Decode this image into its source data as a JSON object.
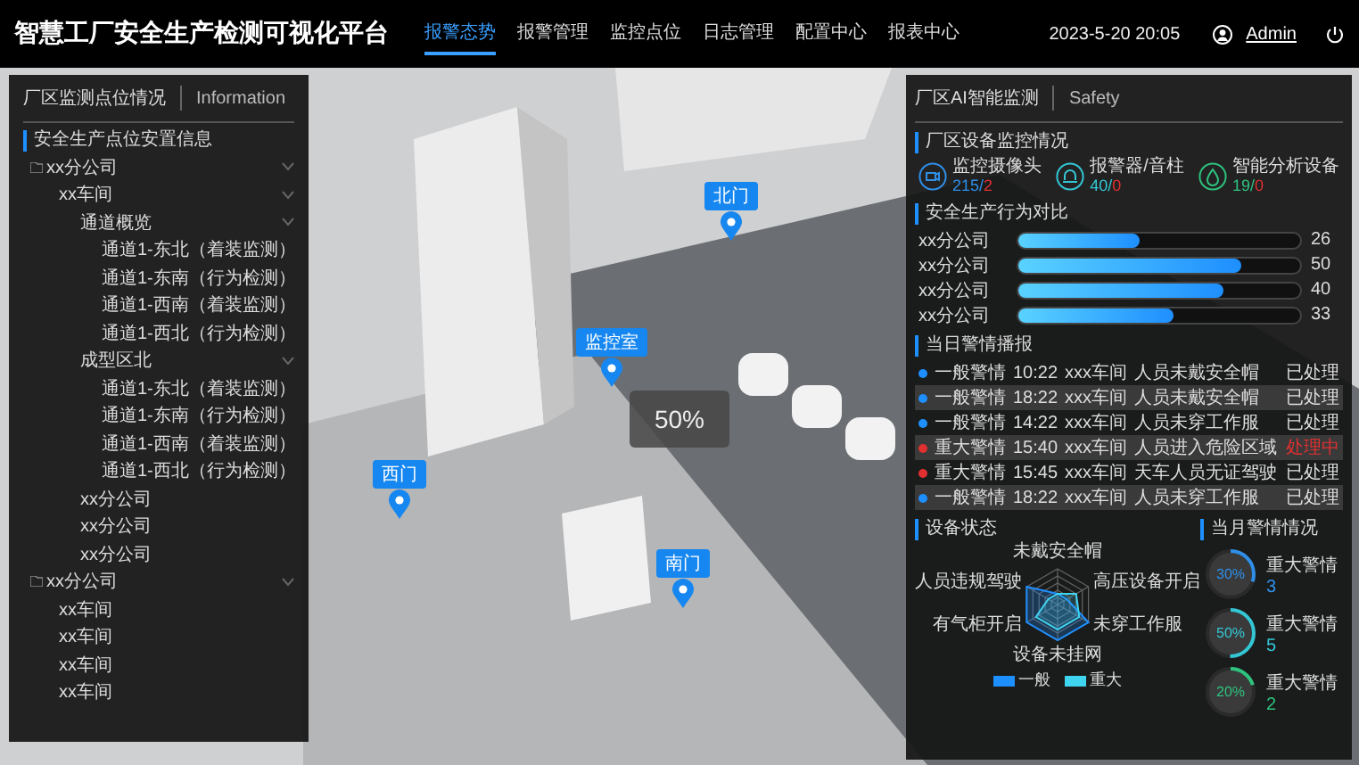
{
  "header": {
    "title": "智慧工厂安全生产检测可视化平台",
    "nav": [
      {
        "label": "报警态势",
        "selected": true
      },
      {
        "label": "报警管理",
        "selected": false
      },
      {
        "label": "监控点位",
        "selected": false
      },
      {
        "label": "日志管理",
        "selected": false
      },
      {
        "label": "配置中心",
        "selected": false
      },
      {
        "label": "报表中心",
        "selected": false
      }
    ],
    "datetime": "2023-5-20 20:05",
    "user": "Admin"
  },
  "left_panel": {
    "title": "厂区监测点位情况",
    "subtitle": "Information",
    "section": "安全生产点位安置信息",
    "tree": [
      {
        "label": "xx分公司",
        "expanded": true,
        "children": [
          {
            "label": "xx车间",
            "expanded": true,
            "children": [
              {
                "label": "通道概览",
                "expanded": true,
                "children": [
                  {
                    "label": "通道1-东北（着装监测）"
                  },
                  {
                    "label": "通道1-东南（行为检测）"
                  },
                  {
                    "label": "通道1-西南（着装监测）"
                  },
                  {
                    "label": "通道1-西北（行为检测）"
                  }
                ]
              },
              {
                "label": "成型区北",
                "expanded": true,
                "children": [
                  {
                    "label": "通道1-东北（着装监测）"
                  },
                  {
                    "label": "通道1-东南（行为检测）"
                  },
                  {
                    "label": "通道1-西南（着装监测）"
                  },
                  {
                    "label": "通道1-西北（行为检测）"
                  }
                ]
              },
              {
                "label": "xx分公司"
              },
              {
                "label": "xx分公司"
              },
              {
                "label": "xx分公司"
              }
            ]
          }
        ]
      },
      {
        "label": "xx分公司",
        "expanded": true,
        "children": [
          {
            "label": "xx车间"
          },
          {
            "label": "xx车间"
          },
          {
            "label": "xx车间"
          },
          {
            "label": "xx车间"
          }
        ]
      }
    ]
  },
  "scene": {
    "pins": [
      {
        "label": "北门"
      },
      {
        "label": "监控室"
      },
      {
        "label": "西门"
      },
      {
        "label": "南门"
      }
    ],
    "loading": "50%"
  },
  "right_panel": {
    "title": "厂区AI智能监测",
    "subtitle": "Safety",
    "devices_title": "厂区设备监控情况",
    "devices": [
      {
        "kind": "camera",
        "name": "监控摄像头",
        "online": "215",
        "separator": "/",
        "offline": "2",
        "color": "#2f8fe8"
      },
      {
        "kind": "alarm",
        "name": "报警器/音柱",
        "online": "40",
        "separator": "/",
        "offline": "0",
        "color": "#33c7d6"
      },
      {
        "kind": "analyzer",
        "name": "智能分析设备",
        "online": "19",
        "separator": "/",
        "offline": "0",
        "color": "#2ec27e"
      }
    ],
    "behavior_title": "安全生产行为对比",
    "behavior": [
      {
        "name": "xx分公司",
        "level": 0.43,
        "value": "26"
      },
      {
        "name": "xx分公司",
        "level": 0.79,
        "value": "50"
      },
      {
        "name": "xx分公司",
        "level": 0.73,
        "value": "40"
      },
      {
        "name": "xx分公司",
        "level": 0.55,
        "value": "33"
      }
    ],
    "alarms_title": "当日警情播报",
    "alarms": [
      {
        "level": "一般警情",
        "color": "#1e8fff",
        "time": "10:22",
        "place": "xxx车间",
        "event": "人员未戴安全帽",
        "status": "已处理",
        "processed": true
      },
      {
        "level": "一般警情",
        "color": "#1e8fff",
        "time": "18:22",
        "place": "xxx车间",
        "event": "人员未戴安全帽",
        "status": "已处理",
        "processed": true
      },
      {
        "level": "一般警情",
        "color": "#1e8fff",
        "time": "14:22",
        "place": "xxx车间",
        "event": "人员未穿工作服",
        "status": "已处理",
        "processed": true
      },
      {
        "level": "重大警情",
        "color": "#e03030",
        "time": "15:40",
        "place": "xxx车间",
        "event": "人员进入危险区域",
        "status": "处理中",
        "processed": false
      },
      {
        "level": "重大警情",
        "color": "#e03030",
        "time": "15:45",
        "place": "xxx车间",
        "event": "天车人员无证驾驶",
        "status": "已处理",
        "processed": true
      },
      {
        "level": "一般警情",
        "color": "#1e8fff",
        "time": "18:22",
        "place": "xxx车间",
        "event": "人员未穿工作服",
        "status": "已处理",
        "processed": true
      }
    ],
    "status_title": "设备状态",
    "radar_labels": [
      "未戴安全帽",
      "高压设备开启",
      "未穿工作服",
      "设备未挂网",
      "有气柜开启",
      "人员违规驾驶"
    ],
    "legend": [
      {
        "label": "一般",
        "color": "#1e8fff"
      },
      {
        "label": "重大",
        "color": "#3fd4f0"
      }
    ],
    "month_title": "当月警情情况",
    "month": [
      {
        "percent": "30%",
        "level": 0.3,
        "label": "重大警情",
        "count": "3",
        "color": "#2f8fe8"
      },
      {
        "percent": "50%",
        "level": 0.5,
        "label": "重大警情",
        "count": "5",
        "color": "#33c7d6"
      },
      {
        "percent": "20%",
        "level": 0.2,
        "label": "重大警情",
        "count": "2",
        "color": "#2ec27e"
      }
    ]
  }
}
